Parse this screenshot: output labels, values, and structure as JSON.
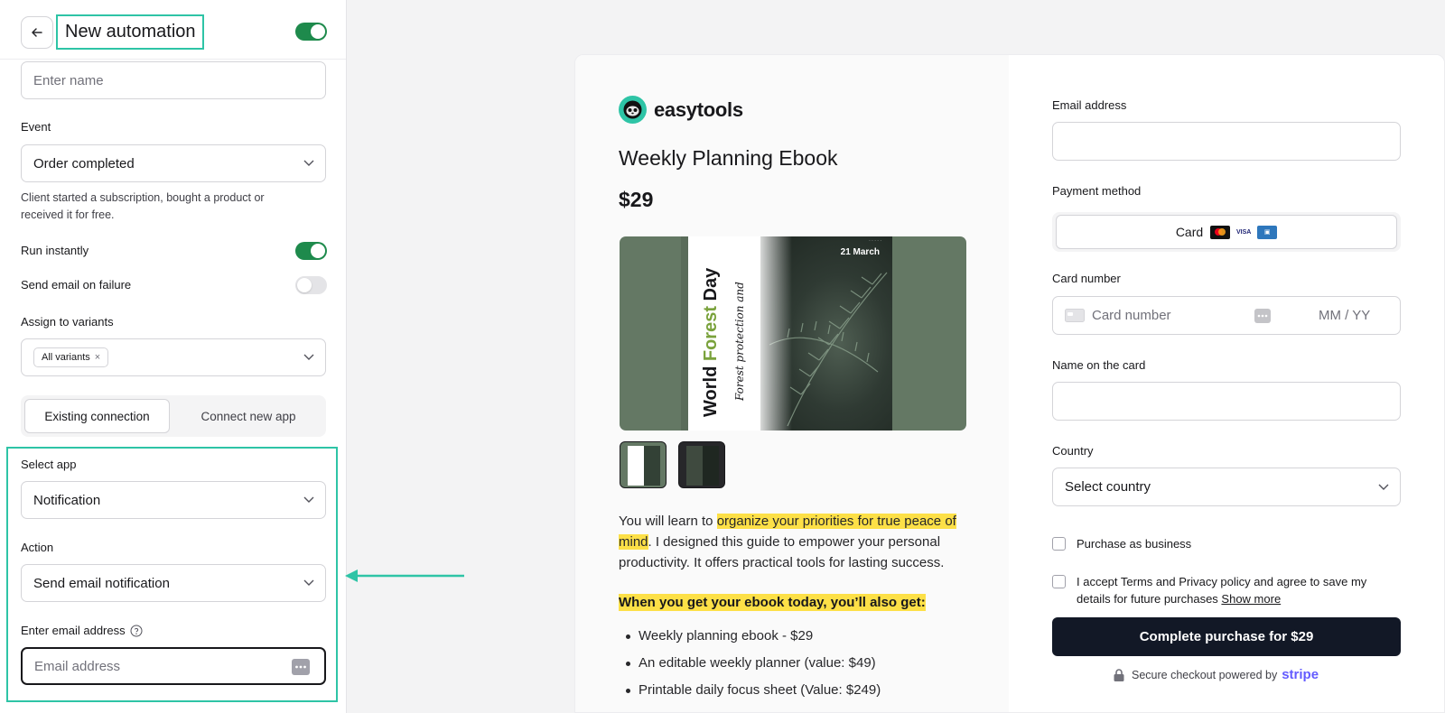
{
  "sidebar": {
    "header": {
      "title": "New automation",
      "enabled": true
    },
    "name_input": {
      "placeholder": "Enter name"
    },
    "event": {
      "label": "Event",
      "value": "Order completed",
      "help": "Client started a subscription, bought a product or received it for free."
    },
    "run_instantly": {
      "label": "Run instantly",
      "enabled": true
    },
    "send_email_on_failure": {
      "label": "Send email on failure",
      "enabled": false
    },
    "variants": {
      "label": "Assign to variants",
      "chip": "All variants",
      "chip_remove": "×"
    },
    "connection_tabs": {
      "existing": "Existing connection",
      "new": "Connect new app",
      "active": "existing"
    },
    "select_app": {
      "label": "Select app",
      "value": "Notification"
    },
    "action": {
      "label": "Action",
      "value": "Send email notification"
    },
    "email": {
      "label": "Enter email address",
      "placeholder": "Email address"
    }
  },
  "checkout": {
    "brand": "easytools",
    "product_title": "Weekly Planning Ebook",
    "price": "$29",
    "cover": {
      "date": "21 March",
      "title_part1": "World ",
      "title_part2": "Forest",
      "title_part3": " Day",
      "subtitle": "Forest protection and"
    },
    "description": {
      "intro": "You will learn to ",
      "highlight": "organize your priorities for true peace of mind",
      "rest": ". I designed this guide to empower your personal productivity. It offers practical tools for lasting success."
    },
    "bonus_heading": "When you get your ebook today, you’ll also get:",
    "bullets": [
      "Weekly planning ebook - $29",
      "An editable weekly planner (value: $49)",
      "Printable daily focus sheet (Value: $249)"
    ],
    "form": {
      "email_label": "Email address",
      "payment_label": "Payment method",
      "payment_option": "Card",
      "card_label": "Card number",
      "card_placeholder": "Card number",
      "expiry_placeholder": "MM / YY",
      "name_label": "Name on the card",
      "country_label": "Country",
      "country_value": "Select country",
      "business_label": "Purchase as business",
      "terms_text": "I accept Terms and Privacy policy and agree to save my details for future purchases ",
      "terms_link": "Show more",
      "buy_button": "Complete purchase for $29",
      "secure_text": "Secure checkout powered by",
      "stripe": "stripe"
    }
  },
  "colors": {
    "accent": "#2ec4a6",
    "toggle_on": "#1e8a4c",
    "highlight": "#fde047",
    "button_dark": "#121826",
    "stripe": "#635bff"
  }
}
